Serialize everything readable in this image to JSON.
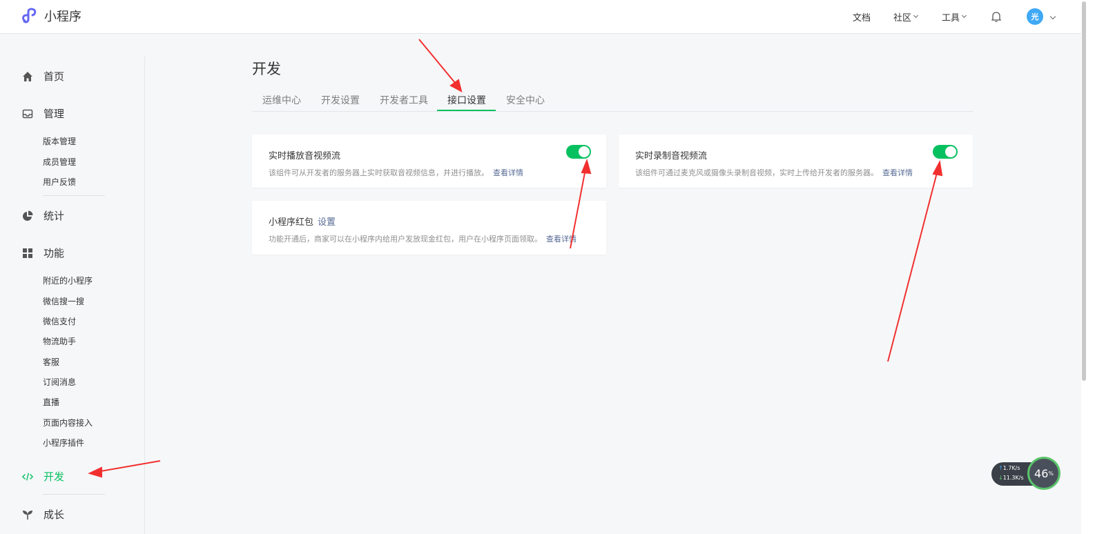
{
  "header": {
    "app_title": "小程序",
    "nav": [
      {
        "label": "文档"
      },
      {
        "label": "社区"
      },
      {
        "label": "工具"
      }
    ],
    "avatar_text": "光"
  },
  "sidebar": {
    "home": "首页",
    "manage": "管理",
    "manage_items": [
      "版本管理",
      "成员管理",
      "用户反馈"
    ],
    "stats": "统计",
    "features": "功能",
    "feature_items": [
      "附近的小程序",
      "微信搜一搜",
      "微信支付",
      "物流助手",
      "客服",
      "订阅消息",
      "直播",
      "页面内容接入",
      "小程序插件"
    ],
    "develop": "开发",
    "growth": "成长"
  },
  "main": {
    "title": "开发",
    "tabs": [
      "运维中心",
      "开发设置",
      "开发者工具",
      "接口设置",
      "安全中心"
    ],
    "selected_tab": "接口设置",
    "cards": [
      {
        "title": "实时播放音视频流",
        "desc": "该组件可从开发者的服务器上实时获取音视频信息，并进行播放。",
        "link": "查看详情",
        "enabled": true
      },
      {
        "title": "实时录制音视频流",
        "desc": "该组件可通过麦克风或摄像头录制音视频，实时上传给开发者的服务器。",
        "link": "查看详情",
        "enabled": true
      },
      {
        "title": "小程序红包",
        "setting_link": "设置",
        "desc": "功能开通后，商家可以在小程序内给用户发放现金红包，用户在小程序页面领取。",
        "link": "查看详情"
      }
    ]
  },
  "speed_widget": {
    "up": "1.7",
    "down": "11.3",
    "unit": "K/s",
    "percent": "46",
    "percent_unit": "%"
  },
  "colors": {
    "accent": "#07c160",
    "link": "#576b95",
    "annotation_arrow": "#f22f2f"
  }
}
